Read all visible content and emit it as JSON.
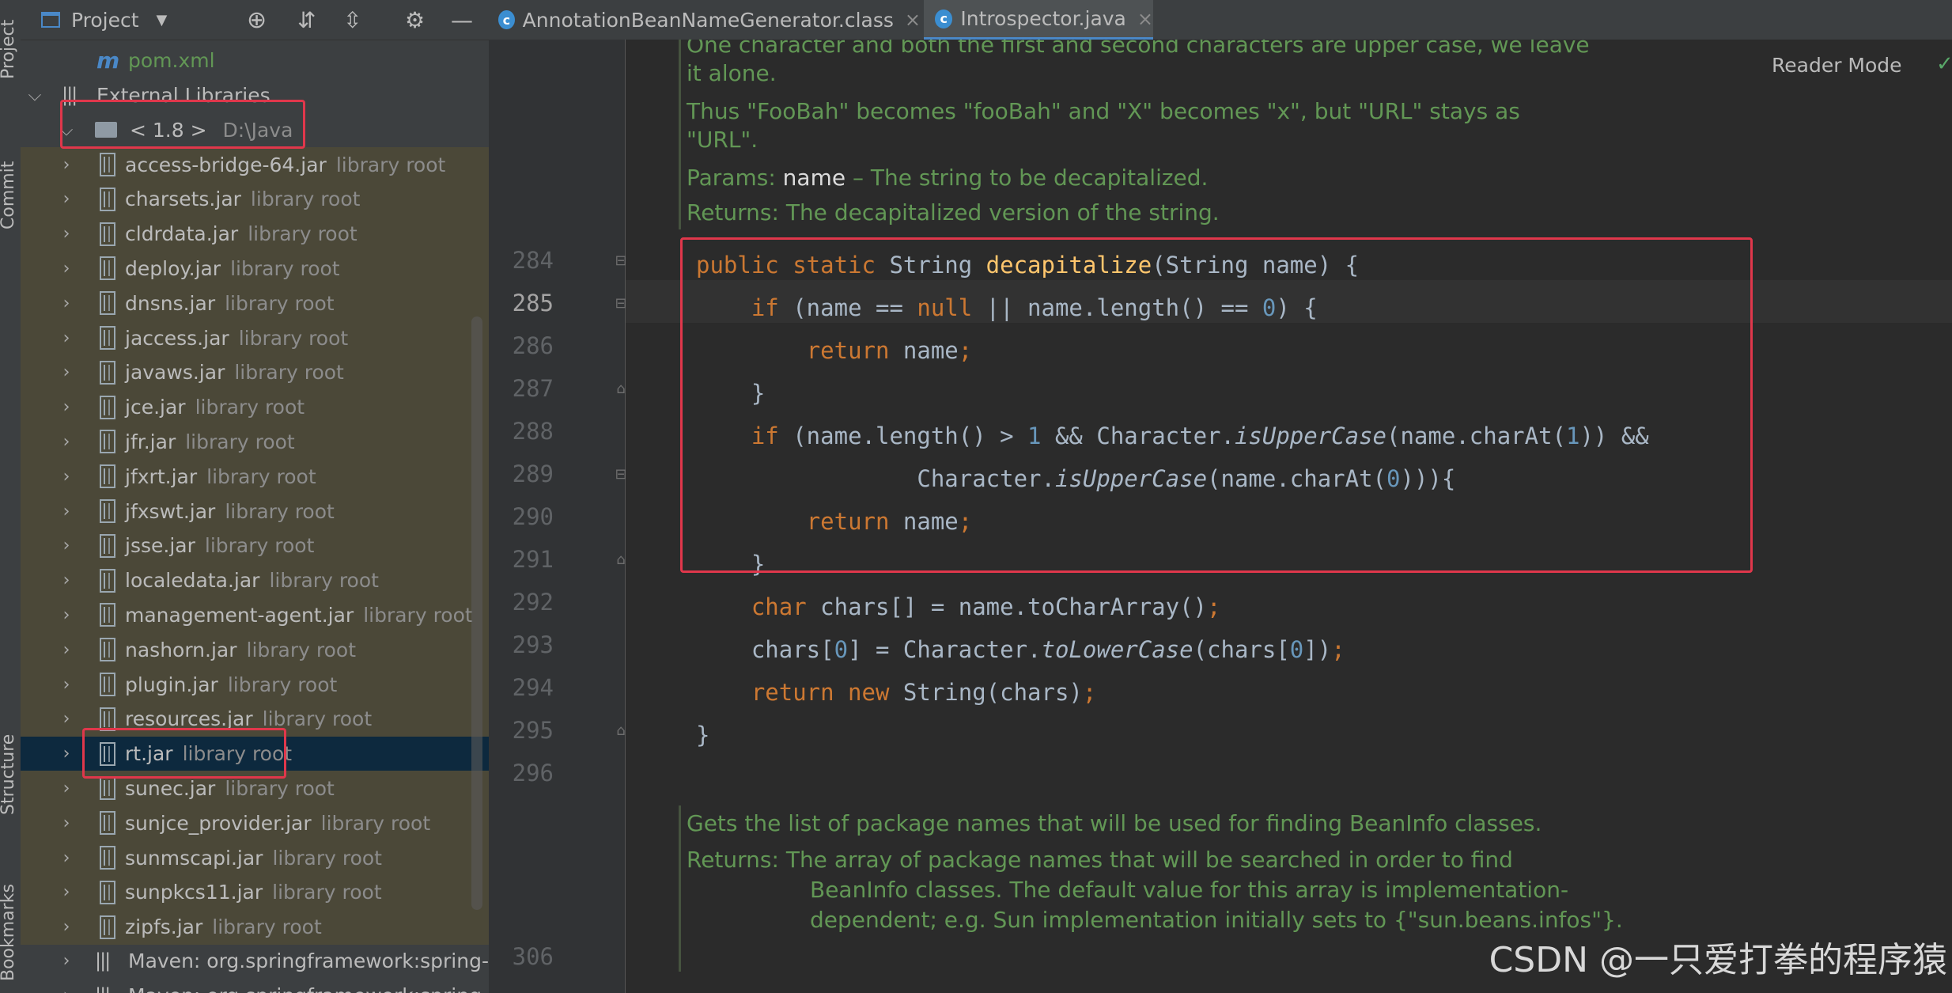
{
  "left_strip": {
    "tabs": [
      "Project",
      "Commit",
      "Structure",
      "Bookmarks"
    ]
  },
  "project_panel": {
    "title": "Project",
    "pom": "pom.xml",
    "external_libraries": "External Libraries",
    "jdk": {
      "label": "< 1.8 >",
      "path": "D:\\Java"
    },
    "jar_hint": "library root",
    "jars": [
      "access-bridge-64.jar",
      "charsets.jar",
      "cldrdata.jar",
      "deploy.jar",
      "dnsns.jar",
      "jaccess.jar",
      "javaws.jar",
      "jce.jar",
      "jfr.jar",
      "jfxrt.jar",
      "jfxswt.jar",
      "jsse.jar",
      "localedata.jar",
      "management-agent.jar",
      "nashorn.jar",
      "plugin.jar",
      "resources.jar",
      "rt.jar",
      "sunec.jar",
      "sunjce_provider.jar",
      "sunmscapi.jar",
      "sunpkcs11.jar",
      "zipfs.jar"
    ],
    "selected_jar": "rt.jar",
    "maven_items": [
      "Maven: org.springframework:spring-aop",
      "Maven: org.springframework:spring-bea"
    ]
  },
  "tabs": [
    {
      "label": "AnnotationBeanNameGenerator.class",
      "active": false
    },
    {
      "label": "Introspector.java",
      "active": true
    }
  ],
  "editor": {
    "reader_mode": "Reader Mode",
    "doc_top": {
      "line1": "One character and both the first and second characters are upper case, we leave",
      "line2": "it alone.",
      "line3": "Thus \"FooBah\" becomes \"fooBah\" and \"X\" becomes \"x\", but \"URL\" stays as",
      "line4": "\"URL\".",
      "params_label": "Params:",
      "params_name": "name",
      "params_desc": "– The string to be decapitalized.",
      "returns": "Returns: The decapitalized version of the string."
    },
    "line_numbers": [
      "284",
      "285",
      "286",
      "287",
      "288",
      "289",
      "290",
      "291",
      "292",
      "293",
      "294",
      "295",
      "296",
      "306"
    ],
    "current_line": "285",
    "doc_bottom": {
      "line1": "Gets the list of package names that will be used for finding BeanInfo classes.",
      "line2": "Returns: The array of package names that will be searched in order to find",
      "line3": "BeanInfo classes. The default value for this array is implementation-",
      "line4": "dependent; e.g. Sun implementation initially sets to {\"sun.beans.infos\"}."
    }
  },
  "code": {
    "l284": {
      "kw": "public static",
      "type": " String ",
      "fn": "decapitalize",
      "rest": "(String name) {"
    },
    "l285": {
      "kw": "if",
      "a": " (name == ",
      "kw2": "null",
      "b": " || name.length() == ",
      "num": "0",
      "c": ") {"
    },
    "l286": {
      "kw": "return",
      "a": " name",
      "b": ";"
    },
    "l287": {
      "a": "}"
    },
    "l288": {
      "kw": "if",
      "a": " (name.length() > ",
      "num": "1",
      "b": " && Character.",
      "it": "isUpperCase",
      "c": "(name.charAt(",
      "num2": "1",
      "d": ")) &&"
    },
    "l289": {
      "a": "Character.",
      "it": "isUpperCase",
      "b": "(name.charAt(",
      "num": "0",
      "c": "))){"
    },
    "l290": {
      "kw": "return",
      "a": " name",
      "b": ";"
    },
    "l291": {
      "a": "}"
    },
    "l292": {
      "kw": "char",
      "a": " chars[] = name.toCharArray()",
      "b": ";"
    },
    "l293": {
      "a": "chars[",
      "num": "0",
      "b": "] = Character.",
      "it": "toLowerCase",
      "c": "(chars[",
      "num2": "0",
      "d": "])",
      "e": ";"
    },
    "l294": {
      "kw": "return new",
      "a": " String(chars)",
      "b": ";"
    },
    "l295": {
      "a": "}"
    }
  },
  "watermark": "CSDN @一只爱打拳的程序猿",
  "colors": {
    "highlight_box": "#e0374b",
    "keyword": "#cc7832",
    "function": "#ffc66d",
    "number": "#6897bb",
    "doc": "#629755",
    "selection": "#0d293e"
  }
}
